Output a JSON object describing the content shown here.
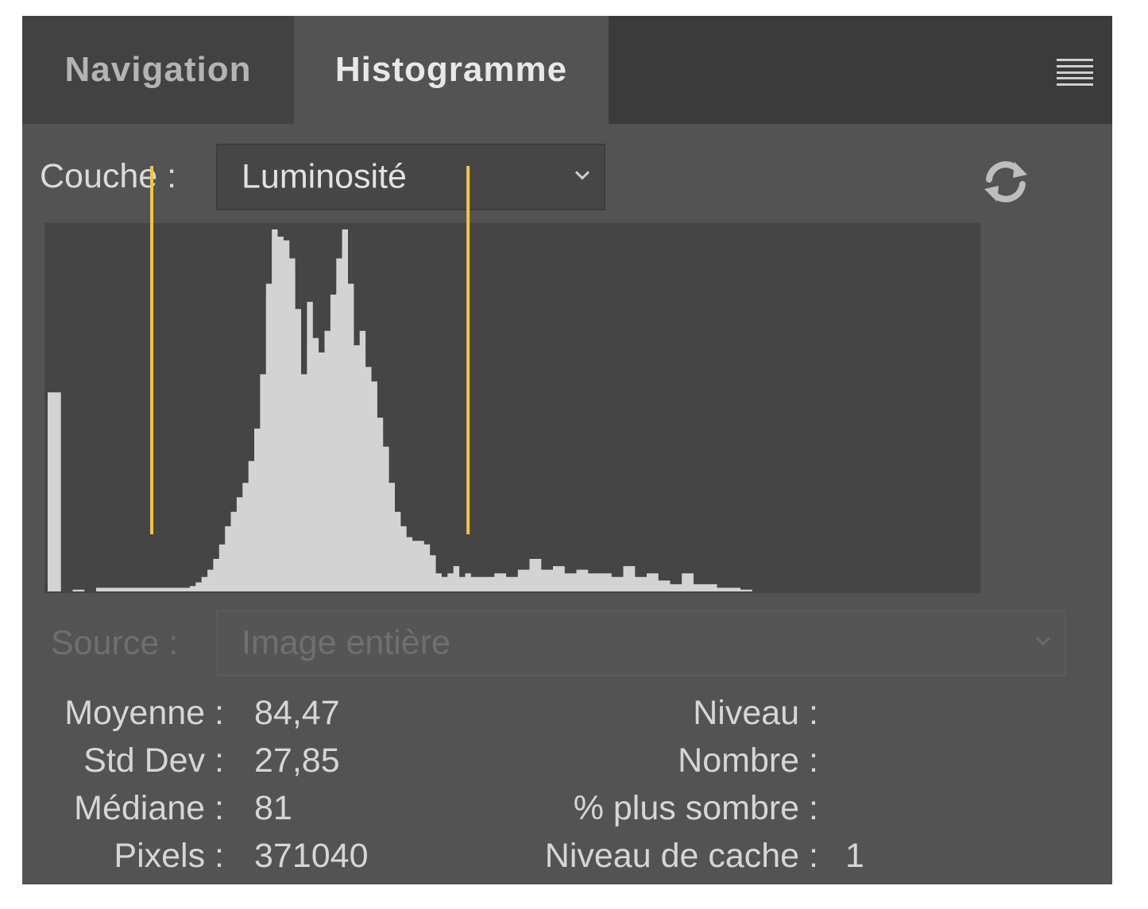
{
  "tabs": {
    "navigation": "Navigation",
    "histogram": "Histogramme",
    "active": "histogram"
  },
  "channel": {
    "label": "Couche :",
    "value": "Luminosité"
  },
  "source": {
    "label": "Source :",
    "value": "Image entière",
    "disabled": true
  },
  "icons": {
    "panel_menu": "panel-menu-icon",
    "refresh": "refresh-icon",
    "dropdown": "chevron-down-icon"
  },
  "colors": {
    "panel_bg": "#535353",
    "histogram_bg": "#454545",
    "histogram_fill": "#d3d3d3",
    "marker": "#f2c641"
  },
  "chart_data": {
    "type": "area",
    "x_range": [
      0,
      255
    ],
    "y_range": [
      0,
      1
    ],
    "markers": [
      35,
      143
    ],
    "x": [
      0,
      4,
      8,
      12,
      16,
      20,
      24,
      28,
      32,
      36,
      40,
      44,
      48,
      50,
      52,
      54,
      56,
      58,
      60,
      62,
      64,
      66,
      68,
      70,
      72,
      74,
      76,
      78,
      80,
      82,
      84,
      86,
      88,
      90,
      92,
      94,
      96,
      98,
      100,
      102,
      104,
      106,
      108,
      110,
      112,
      114,
      116,
      118,
      120,
      122,
      124,
      126,
      128,
      130,
      132,
      134,
      136,
      138,
      140,
      142,
      144,
      148,
      152,
      156,
      160,
      164,
      168,
      172,
      176,
      180,
      184,
      188,
      192,
      196,
      200,
      204,
      208,
      212,
      216,
      220,
      224,
      228,
      232,
      236,
      240,
      244,
      248,
      252,
      255
    ],
    "values": [
      0.55,
      0.0,
      0.005,
      0.0,
      0.01,
      0.01,
      0.01,
      0.01,
      0.01,
      0.01,
      0.01,
      0.01,
      0.015,
      0.025,
      0.04,
      0.06,
      0.09,
      0.13,
      0.18,
      0.22,
      0.26,
      0.3,
      0.36,
      0.45,
      0.6,
      0.85,
      1.0,
      0.98,
      0.97,
      0.92,
      0.78,
      0.6,
      0.8,
      0.7,
      0.66,
      0.72,
      0.82,
      0.92,
      1.0,
      0.85,
      0.68,
      0.72,
      0.62,
      0.58,
      0.48,
      0.4,
      0.3,
      0.22,
      0.18,
      0.15,
      0.14,
      0.14,
      0.13,
      0.1,
      0.05,
      0.04,
      0.05,
      0.07,
      0.04,
      0.05,
      0.04,
      0.04,
      0.05,
      0.04,
      0.06,
      0.09,
      0.06,
      0.07,
      0.05,
      0.06,
      0.05,
      0.05,
      0.04,
      0.07,
      0.04,
      0.05,
      0.03,
      0.02,
      0.05,
      0.02,
      0.02,
      0.01,
      0.01,
      0.005,
      0.0,
      0.0,
      0.0,
      0.0,
      0.0
    ],
    "peak_overlay": {
      "x": [
        74,
        76,
        78,
        80,
        82,
        84,
        86,
        88,
        90,
        92,
        94,
        96,
        98,
        100,
        102,
        104,
        106,
        108,
        110,
        112,
        114
      ],
      "values": [
        0.82,
        0.98,
        0.95,
        0.93,
        0.88,
        0.7,
        0.55,
        0.7,
        0.65,
        0.6,
        0.66,
        0.75,
        0.85,
        0.95,
        0.78,
        0.6,
        0.66,
        0.52,
        0.5,
        0.43,
        0.35
      ]
    }
  },
  "stats": {
    "mean": {
      "label": "Moyenne :",
      "value": "84,47"
    },
    "std_dev": {
      "label": "Std Dev :",
      "value": "27,85"
    },
    "median": {
      "label": "Médiane :",
      "value": "81"
    },
    "pixels": {
      "label": "Pixels :",
      "value": "371040"
    },
    "level": {
      "label": "Niveau :",
      "value": ""
    },
    "count": {
      "label": "Nombre :",
      "value": ""
    },
    "percentile": {
      "label": "% plus sombre :",
      "value": ""
    },
    "cache_level": {
      "label": "Niveau de cache :",
      "value": "1"
    }
  }
}
